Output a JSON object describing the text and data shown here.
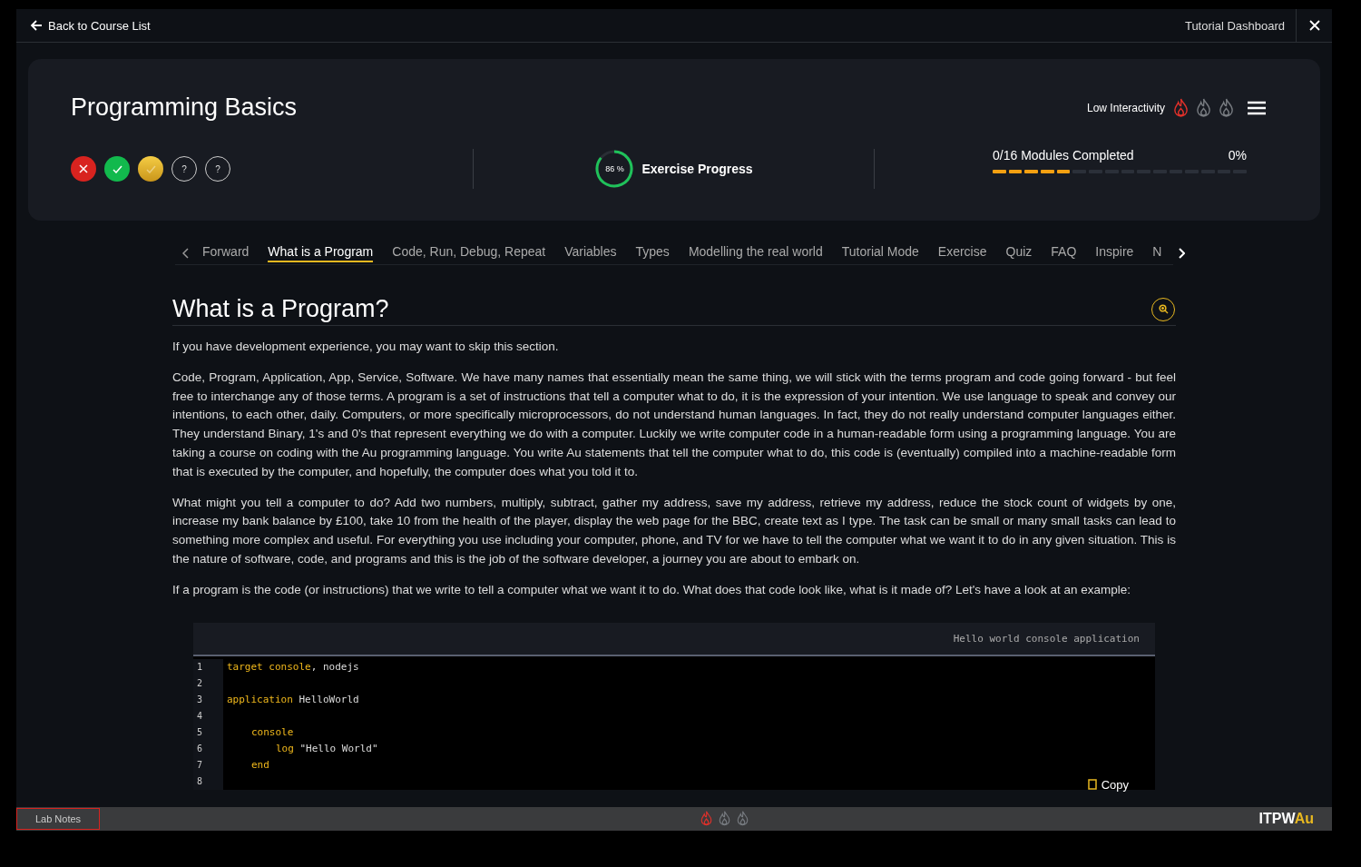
{
  "top_bar": {
    "back_link": "Back to Course List",
    "dashboard_link": "Tutorial Dashboard"
  },
  "header": {
    "title": "Programming Basics",
    "interactivity": {
      "label": "Low Interactivity",
      "flames": [
        {
          "lit": true
        },
        {
          "lit": false
        },
        {
          "lit": false
        }
      ]
    },
    "results": [
      {
        "kind": "wrong"
      },
      {
        "kind": "correct"
      },
      {
        "kind": "gold"
      },
      {
        "kind": "unknown",
        "text": "?"
      },
      {
        "kind": "unknown",
        "text": "?"
      }
    ],
    "exercise": {
      "level": 0.86,
      "reading": "86 %",
      "label": "Exercise Progress"
    },
    "modules": {
      "label": "0/16 Modules Completed",
      "percent": "0%",
      "segments": [
        {
          "filled": true
        },
        {
          "filled": true
        },
        {
          "filled": true
        },
        {
          "filled": true
        },
        {
          "filled": true
        },
        {
          "filled": false
        },
        {
          "filled": false
        },
        {
          "filled": false
        },
        {
          "filled": false
        },
        {
          "filled": false
        },
        {
          "filled": false
        },
        {
          "filled": false
        },
        {
          "filled": false
        },
        {
          "filled": false
        },
        {
          "filled": false
        },
        {
          "filled": false
        }
      ]
    }
  },
  "tabs": [
    {
      "label": "Forward",
      "selected": false
    },
    {
      "label": "What is a Program",
      "selected": true
    },
    {
      "label": "Code, Run, Debug, Repeat",
      "selected": false
    },
    {
      "label": "Variables",
      "selected": false
    },
    {
      "label": "Types",
      "selected": false
    },
    {
      "label": "Modelling the real world",
      "selected": false
    },
    {
      "label": "Tutorial Mode",
      "selected": false
    },
    {
      "label": "Exercise",
      "selected": false
    },
    {
      "label": "Quiz",
      "selected": false
    },
    {
      "label": "FAQ",
      "selected": false
    },
    {
      "label": "Inspire",
      "selected": false
    },
    {
      "label": "N",
      "selected": false
    }
  ],
  "article": {
    "heading": "What is a Program?",
    "paragraphs": [
      "If you have development experience, you may want to skip this section.",
      "Code, Program, Application, App, Service, Software. We have many names that essentially mean the same thing, we will stick with the terms program and code going forward - but feel free to interchange any of those terms. A program is a set of instructions that tell a computer what to do, it is the expression of your intention. We use language to speak and convey our intentions, to each other, daily. Computers, or more specifically microprocessors, do not understand human languages. In fact, they do not really understand computer languages either. They understand Binary, 1's and 0's that represent everything we do with a computer. Luckily we write computer code in a human-readable form using a programming language. You are taking a course on coding with the Au programming language. You write Au statements that tell the computer what to do, this code is (eventually) compiled into a machine-readable form that is executed by the computer, and hopefully, the computer does what you told it to.",
      "What might you tell a computer to do? Add two numbers, multiply, subtract, gather my address, save my address, retrieve my address, reduce the stock count of widgets by one, increase my bank balance by £100, take 10 from the health of the player, display the web page for the BBC, create text as I type. The task can be small or many small tasks can lead to something more complex and useful. For everything you use including your computer, phone, and TV for we have to tell the computer what we want it to do in any given situation. This is the nature of software, code, and programs and this is the job of the software developer, a journey you are about to embark on.",
      "If a program is the code (or instructions) that we write to tell a computer what we want it to do. What does that code look like, what is it made of? Let's have a look at an example:"
    ]
  },
  "code_block": {
    "caption": "Hello world console application",
    "lines": [
      {
        "number": "1",
        "tokens": [
          {
            "kind": "keyword",
            "text": "target console"
          },
          {
            "kind": "plain",
            "text": ", nodejs"
          }
        ]
      },
      {
        "number": "2"
      },
      {
        "number": "3",
        "tokens": [
          {
            "kind": "keyword",
            "text": "application"
          },
          {
            "kind": "plain",
            "text": " HelloWorld"
          }
        ],
        "children": [
          {
            "number": "4"
          },
          {
            "number": "5",
            "tokens": [
              {
                "kind": "keyword",
                "text": "console"
              }
            ],
            "children": [
              {
                "number": "6",
                "tokens": [
                  {
                    "kind": "keyword",
                    "text": "log"
                  },
                  {
                    "kind": "plain",
                    "text": " \"Hello World\""
                  }
                ]
              }
            ]
          },
          {
            "number": "7",
            "tokens": [
              {
                "kind": "keyword",
                "text": "end"
              }
            ]
          }
        ]
      },
      {
        "number": "8"
      }
    ],
    "copy_button": "Copy"
  },
  "footer": {
    "lab_notes": "Lab Notes",
    "flames": [
      {
        "lit": true
      },
      {
        "lit": false
      },
      {
        "lit": false
      }
    ],
    "logo": {
      "main": "ITPW",
      "accent": "Au"
    }
  }
}
